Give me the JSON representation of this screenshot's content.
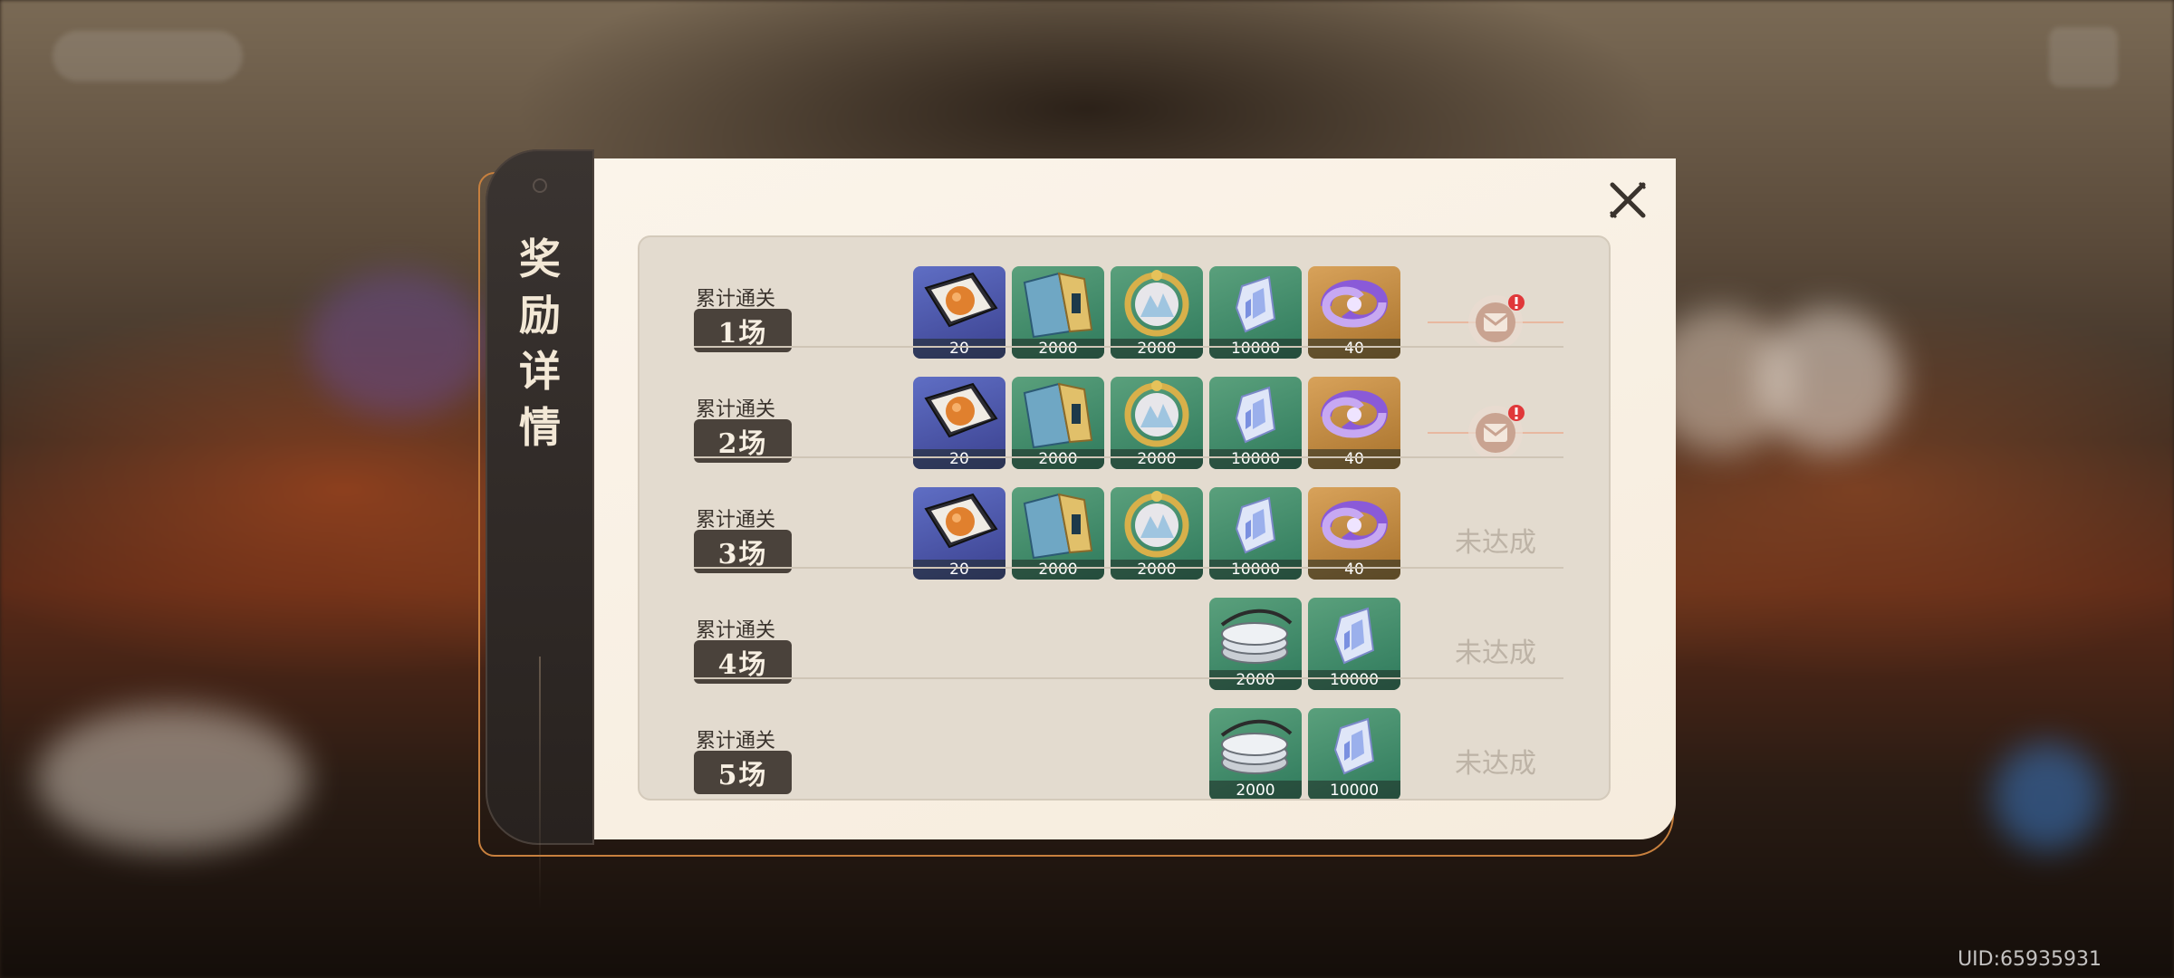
{
  "dialog": {
    "title_chars": [
      "奖",
      "励",
      "详",
      "情"
    ]
  },
  "rows": [
    {
      "label": "累计通关",
      "count": "1场",
      "items": [
        {
          "icon": "cookbook-icon",
          "qty": "20",
          "bg": "purple"
        },
        {
          "icon": "exp-book-icon",
          "qty": "2000",
          "bg": "green"
        },
        {
          "icon": "crown-ore-icon",
          "qty": "2000",
          "bg": "green"
        },
        {
          "icon": "crystal-icon",
          "qty": "10000",
          "bg": "green"
        },
        {
          "icon": "primogem-swirl-icon",
          "qty": "40",
          "bg": "gold"
        }
      ],
      "status": "claimable"
    },
    {
      "label": "累计通关",
      "count": "2场",
      "items": [
        {
          "icon": "cookbook-icon",
          "qty": "20",
          "bg": "purple"
        },
        {
          "icon": "exp-book-icon",
          "qty": "2000",
          "bg": "green"
        },
        {
          "icon": "crown-ore-icon",
          "qty": "2000",
          "bg": "green"
        },
        {
          "icon": "crystal-icon",
          "qty": "10000",
          "bg": "green"
        },
        {
          "icon": "primogem-swirl-icon",
          "qty": "40",
          "bg": "gold"
        }
      ],
      "status": "claimable"
    },
    {
      "label": "累计通关",
      "count": "3场",
      "items": [
        {
          "icon": "cookbook-icon",
          "qty": "20",
          "bg": "purple"
        },
        {
          "icon": "exp-book-icon",
          "qty": "2000",
          "bg": "green"
        },
        {
          "icon": "crown-ore-icon",
          "qty": "2000",
          "bg": "green"
        },
        {
          "icon": "crystal-icon",
          "qty": "10000",
          "bg": "green"
        },
        {
          "icon": "primogem-swirl-icon",
          "qty": "40",
          "bg": "gold"
        }
      ],
      "status_text": "未达成"
    },
    {
      "label": "累计通关",
      "count": "4场",
      "items": [
        {
          "icon": "coin-stack-icon",
          "qty": "2000",
          "bg": "green"
        },
        {
          "icon": "crystal-icon",
          "qty": "10000",
          "bg": "green"
        }
      ],
      "status_text": "未达成"
    },
    {
      "label": "累计通关",
      "count": "5场",
      "items": [
        {
          "icon": "coin-stack-icon",
          "qty": "2000",
          "bg": "green"
        },
        {
          "icon": "crystal-icon",
          "qty": "10000",
          "bg": "green"
        }
      ],
      "status_text": "未达成"
    }
  ],
  "footer": {
    "uid": "UID:65935931"
  }
}
